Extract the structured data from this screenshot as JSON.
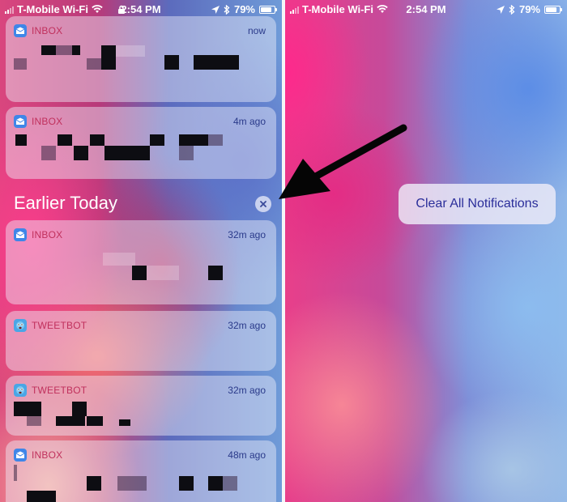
{
  "left_phone": {
    "status_bar": {
      "carrier": "T-Mobile Wi-Fi",
      "time": "2:54 PM",
      "battery": "79%"
    },
    "section_title": "Earlier Today",
    "notifications": [
      {
        "app": "INBOX",
        "time": "now",
        "icon": "inbox-app-icon"
      },
      {
        "app": "INBOX",
        "time": "4m ago",
        "icon": "inbox-app-icon"
      },
      {
        "app": "INBOX",
        "time": "32m ago",
        "icon": "inbox-app-icon"
      },
      {
        "app": "TWEETBOT",
        "time": "32m ago",
        "icon": "tweetbot-app-icon"
      },
      {
        "app": "TWEETBOT",
        "time": "32m ago",
        "icon": "tweetbot-app-icon"
      },
      {
        "app": "INBOX",
        "time": "48m ago",
        "icon": "inbox-app-icon"
      }
    ]
  },
  "right_phone": {
    "status_bar": {
      "carrier": "T-Mobile Wi-Fi",
      "time": "2:54 PM",
      "battery": "79%"
    },
    "clear_all_label": "Clear All Notifications"
  },
  "colors": {
    "app_name": "#c0305c",
    "timestamp": "#2a3a8a",
    "clear_label": "#2b2e9a"
  }
}
